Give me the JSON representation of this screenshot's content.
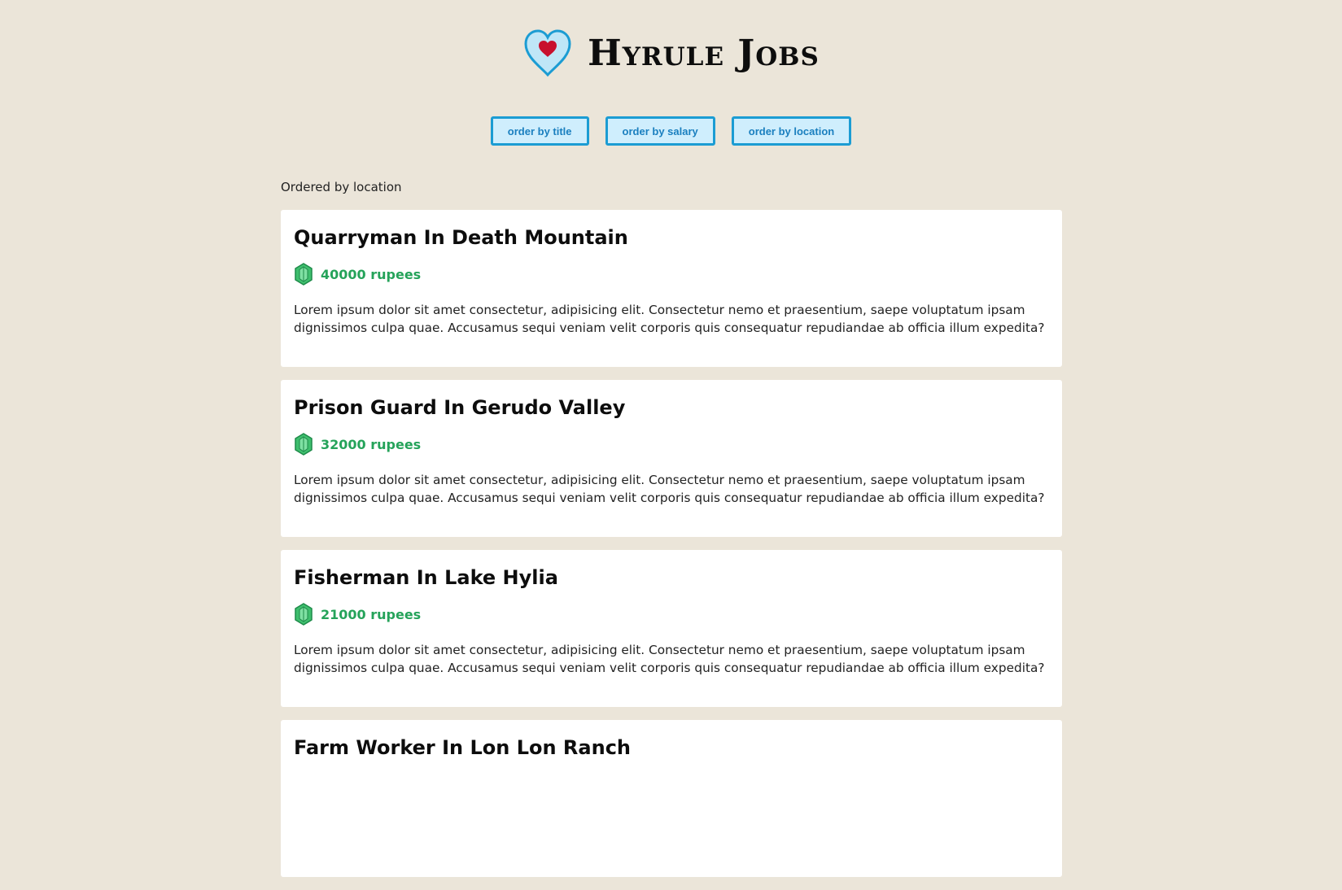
{
  "header": {
    "title": "Hyrule Jobs",
    "logo_icon": "heart-container-icon"
  },
  "controls": {
    "order_by_title": "order by title",
    "order_by_salary": "order by salary",
    "order_by_location": "order by location"
  },
  "status": {
    "ordered_label": "Ordered by location"
  },
  "jobs": [
    {
      "title": "Quarryman In Death Mountain",
      "salary": "40000 rupees",
      "description": "Lorem ipsum dolor sit amet consectetur, adipisicing elit. Consectetur nemo et praesentium, saepe voluptatum ipsam dignissimos culpa quae. Accusamus sequi veniam velit corporis quis consequatur repudiandae ab officia illum expedita?"
    },
    {
      "title": "Prison Guard In Gerudo Valley",
      "salary": "32000 rupees",
      "description": "Lorem ipsum dolor sit amet consectetur, adipisicing elit. Consectetur nemo et praesentium, saepe voluptatum ipsam dignissimos culpa quae. Accusamus sequi veniam velit corporis quis consequatur repudiandae ab officia illum expedita?"
    },
    {
      "title": "Fisherman In Lake Hylia",
      "salary": "21000 rupees",
      "description": "Lorem ipsum dolor sit amet consectetur, adipisicing elit. Consectetur nemo et praesentium, saepe voluptatum ipsam dignissimos culpa quae. Accusamus sequi veniam velit corporis quis consequatur repudiandae ab officia illum expedita?"
    },
    {
      "title": "Farm Worker In Lon Lon Ranch"
    }
  ],
  "colors": {
    "background": "#ebe5d9",
    "button_bg": "#cfeefd",
    "button_border": "#1b9cd3",
    "salary_green": "#25a35a",
    "heart_red": "#c8102e",
    "heart_outline": "#1b9cd3"
  }
}
